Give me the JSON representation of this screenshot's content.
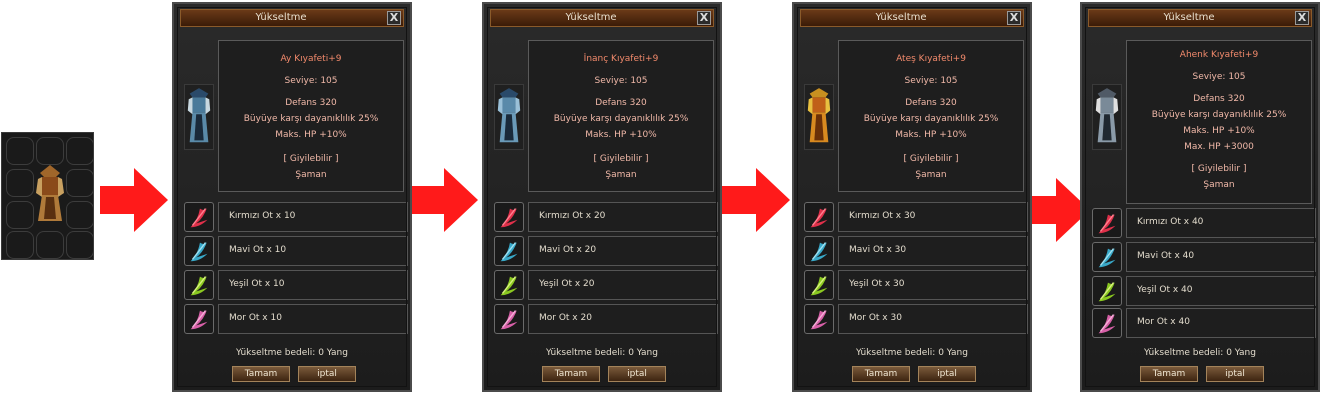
{
  "colors": {
    "arrow": "#ff1a1a",
    "title_bar": "#5a2e12",
    "item_name": "#f28a6c",
    "item_info": "#f0b8a8"
  },
  "windows": [
    {
      "title": "Yükseltme",
      "close_label": "X",
      "item": {
        "name": "Ay Kıyafeti+9",
        "level": "Seviye: 105",
        "defense": "Defans 320",
        "bonus1": "Büyüye karşı dayanıklılık 25%",
        "bonus2": "Maks. HP +10%",
        "bonus3": "",
        "wearable": "[ Giyilebilir ]",
        "class": "Şaman"
      },
      "materials": [
        {
          "name": "Kırmızı Ot x 10",
          "icon": "red-herb-icon"
        },
        {
          "name": "Mavi Ot x 10",
          "icon": "blue-herb-icon"
        },
        {
          "name": "Yeşil Ot x 10",
          "icon": "green-herb-icon"
        },
        {
          "name": "Mor Ot x 10",
          "icon": "purple-herb-icon"
        }
      ],
      "cost": "Yükseltme bedeli: 0 Yang",
      "ok_label": "Tamam",
      "cancel_label": "iptal"
    },
    {
      "title": "Yükseltme",
      "close_label": "X",
      "item": {
        "name": "İnanç Kıyafeti+9",
        "level": "Seviye: 105",
        "defense": "Defans 320",
        "bonus1": "Büyüye karşı dayanıklılık 25%",
        "bonus2": "Maks. HP +10%",
        "bonus3": "",
        "wearable": "[ Giyilebilir ]",
        "class": "Şaman"
      },
      "materials": [
        {
          "name": "Kırmızı Ot x 20",
          "icon": "red-herb-icon"
        },
        {
          "name": "Mavi Ot x 20",
          "icon": "blue-herb-icon"
        },
        {
          "name": "Yeşil Ot x 20",
          "icon": "green-herb-icon"
        },
        {
          "name": "Mor Ot x 20",
          "icon": "purple-herb-icon"
        }
      ],
      "cost": "Yükseltme bedeli: 0 Yang",
      "ok_label": "Tamam",
      "cancel_label": "iptal"
    },
    {
      "title": "Yükseltme",
      "close_label": "X",
      "item": {
        "name": "Ateş Kıyafeti+9",
        "level": "Seviye: 105",
        "defense": "Defans 320",
        "bonus1": "Büyüye karşı dayanıklılık 25%",
        "bonus2": "Maks. HP +10%",
        "bonus3": "",
        "wearable": "[ Giyilebilir ]",
        "class": "Şaman"
      },
      "materials": [
        {
          "name": "Kırmızı Ot x 30",
          "icon": "red-herb-icon"
        },
        {
          "name": "Mavi Ot x 30",
          "icon": "blue-herb-icon"
        },
        {
          "name": "Yeşil Ot x 30",
          "icon": "green-herb-icon"
        },
        {
          "name": "Mor Ot x 30",
          "icon": "purple-herb-icon"
        }
      ],
      "cost": "Yükseltme bedeli: 0 Yang",
      "ok_label": "Tamam",
      "cancel_label": "iptal"
    },
    {
      "title": "Yükseltme",
      "close_label": "X",
      "item": {
        "name": "Ahenk Kıyafeti+9",
        "level": "Seviye: 105",
        "defense": "Defans 320",
        "bonus1": "Büyüye karşı dayanıklılık 25%",
        "bonus2": "Maks. HP +10%",
        "bonus3": "Max. HP +3000",
        "wearable": "[ Giyilebilir ]",
        "class": "Şaman"
      },
      "materials": [
        {
          "name": "Kırmızı Ot x 40",
          "icon": "red-herb-icon"
        },
        {
          "name": "Mavi Ot x 40",
          "icon": "blue-herb-icon"
        },
        {
          "name": "Yeşil Ot x 40",
          "icon": "green-herb-icon"
        },
        {
          "name": "Mor Ot x 40",
          "icon": "purple-herb-icon"
        }
      ],
      "cost": "Yükseltme bedeli: 0 Yang",
      "ok_label": "Tamam",
      "cancel_label": "iptal"
    }
  ]
}
